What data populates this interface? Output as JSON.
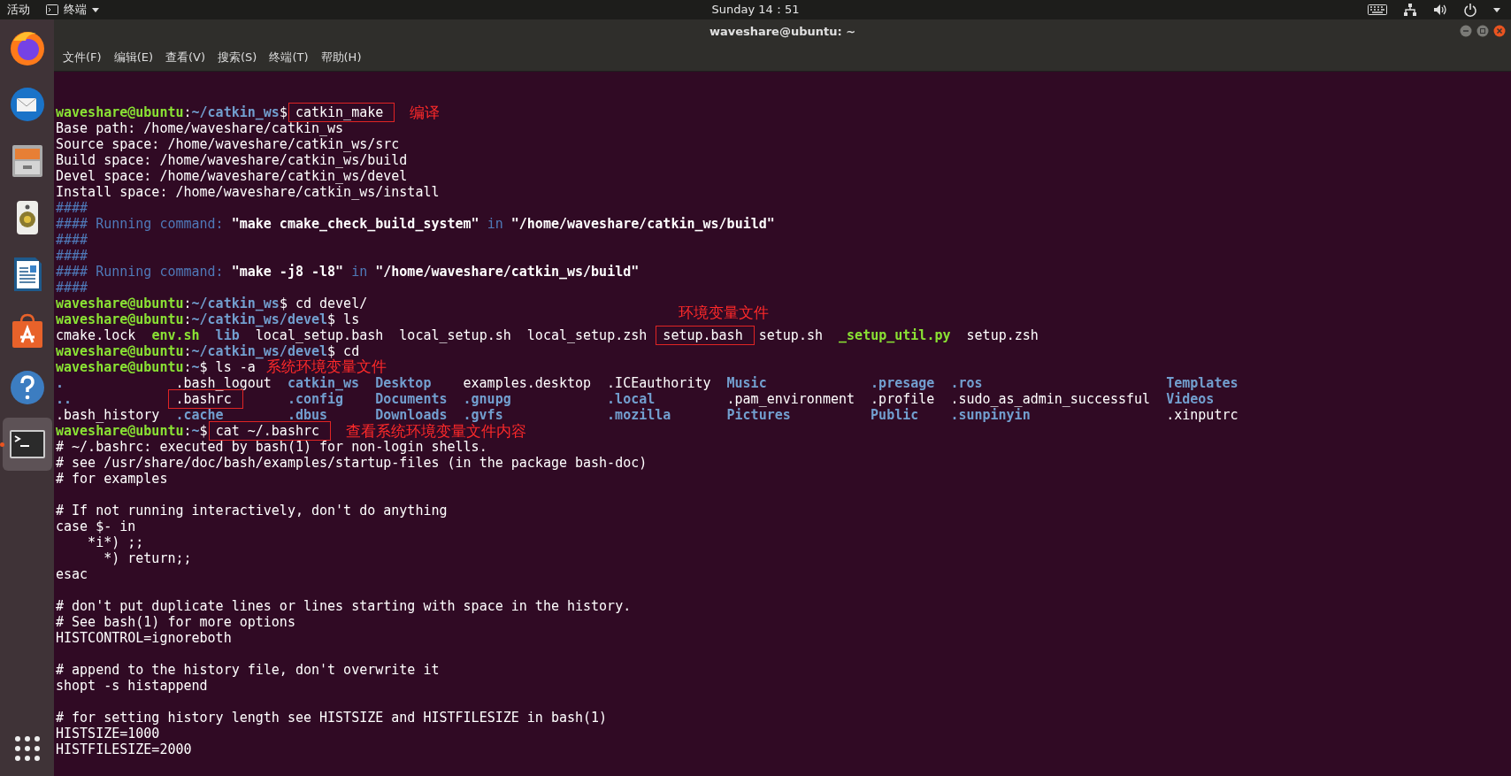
{
  "top_bar": {
    "activities": "活动",
    "app_menu": "终端",
    "clock": "Sunday 14：51"
  },
  "window": {
    "title": "waveshare@ubuntu: ~"
  },
  "menu": [
    "文件(F)",
    "编辑(E)",
    "查看(V)",
    "搜索(S)",
    "终端(T)",
    "帮助(H)"
  ],
  "dock": [
    {
      "kind": "firefox",
      "selected": false
    },
    {
      "kind": "mail",
      "selected": false
    },
    {
      "kind": "files",
      "selected": false
    },
    {
      "kind": "music",
      "selected": false
    },
    {
      "kind": "writer",
      "selected": false
    },
    {
      "kind": "store",
      "selected": false
    },
    {
      "kind": "help",
      "selected": false
    },
    {
      "kind": "terminal",
      "selected": true
    }
  ],
  "terminal": {
    "lines": [
      {
        "kind": "text",
        "segs": [
          {
            "text": "waveshare@ubuntu",
            "kind": "user"
          },
          {
            "text": ":",
            "kind": "plain"
          },
          {
            "text": "~/catkin_ws",
            "kind": "path"
          },
          {
            "text": "$ ",
            "kind": "plain"
          },
          {
            "text": "catkin_make",
            "kind": "plain",
            "box": {
              "note": "编译"
            }
          }
        ]
      },
      {
        "kind": "text",
        "segs": [
          {
            "text": "Base path: /home/waveshare/catkin_ws",
            "kind": "plain"
          }
        ]
      },
      {
        "kind": "text",
        "segs": [
          {
            "text": "Source space: /home/waveshare/catkin_ws/src",
            "kind": "plain"
          }
        ]
      },
      {
        "kind": "text",
        "segs": [
          {
            "text": "Build space: /home/waveshare/catkin_ws/build",
            "kind": "plain"
          }
        ]
      },
      {
        "kind": "text",
        "segs": [
          {
            "text": "Devel space: /home/waveshare/catkin_ws/devel",
            "kind": "plain"
          }
        ]
      },
      {
        "kind": "text",
        "segs": [
          {
            "text": "Install space: /home/waveshare/catkin_ws/install",
            "kind": "plain"
          }
        ]
      },
      {
        "kind": "text",
        "segs": [
          {
            "text": "####",
            "kind": "hash"
          }
        ]
      },
      {
        "kind": "text",
        "segs": [
          {
            "text": "#### Running command: ",
            "kind": "hash"
          },
          {
            "text": "\"make cmake_check_build_system\"",
            "kind": "str"
          },
          {
            "text": " in ",
            "kind": "hash"
          },
          {
            "text": "\"/home/waveshare/catkin_ws/build\"",
            "kind": "str"
          }
        ]
      },
      {
        "kind": "text",
        "segs": [
          {
            "text": "####",
            "kind": "hash"
          }
        ]
      },
      {
        "kind": "text",
        "segs": [
          {
            "text": "####",
            "kind": "hash"
          }
        ]
      },
      {
        "kind": "text",
        "segs": [
          {
            "text": "#### Running command: ",
            "kind": "hash"
          },
          {
            "text": "\"make -j8 -l8\"",
            "kind": "str"
          },
          {
            "text": " in ",
            "kind": "hash"
          },
          {
            "text": "\"/home/waveshare/catkin_ws/build\"",
            "kind": "str"
          }
        ]
      },
      {
        "kind": "text",
        "segs": [
          {
            "text": "####",
            "kind": "hash"
          }
        ]
      },
      {
        "kind": "text",
        "segs": [
          {
            "text": "waveshare@ubuntu",
            "kind": "user"
          },
          {
            "text": ":",
            "kind": "plain"
          },
          {
            "text": "~/catkin_ws",
            "kind": "path"
          },
          {
            "text": "$ cd devel/",
            "kind": "plain"
          }
        ]
      },
      {
        "kind": "text",
        "segs": [
          {
            "text": "waveshare@ubuntu",
            "kind": "user"
          },
          {
            "text": ":",
            "kind": "plain"
          },
          {
            "text": "~/catkin_ws/devel",
            "kind": "path"
          },
          {
            "text": "$ ls",
            "kind": "plain"
          }
        ]
      },
      {
        "kind": "text",
        "segs": [
          {
            "text": "cmake.lock  ",
            "kind": "plain"
          },
          {
            "text": "env.sh",
            "kind": "exec"
          },
          {
            "text": "  lib",
            "kind": "dir"
          },
          {
            "text": "  local_setup.bash  local_setup.sh  local_setup.zsh  ",
            "kind": "plain"
          },
          {
            "text": "setup.bash",
            "kind": "plain",
            "box": {
              "note": "环境变量文件"
            }
          },
          {
            "text": "  setup.sh  ",
            "kind": "plain"
          },
          {
            "text": "_setup_util.py",
            "kind": "exec"
          },
          {
            "text": "  setup.zsh",
            "kind": "plain"
          }
        ]
      },
      {
        "kind": "text",
        "segs": [
          {
            "text": "waveshare@ubuntu",
            "kind": "user"
          },
          {
            "text": ":",
            "kind": "plain"
          },
          {
            "text": "~/catkin_ws/devel",
            "kind": "path"
          },
          {
            "text": "$ cd",
            "kind": "plain"
          }
        ]
      },
      {
        "kind": "text",
        "segs": [
          {
            "text": "waveshare@ubuntu",
            "kind": "user"
          },
          {
            "text": ":",
            "kind": "plain"
          },
          {
            "text": "~",
            "kind": "path"
          },
          {
            "text": "$ ls -a",
            "kind": "plain"
          }
        ]
      },
      {
        "kind": "grid",
        "cells": [
          {
            "text": ".",
            "kind": "dir"
          },
          {
            "text": ".bash_logout",
            "kind": "plain"
          },
          {
            "text": "catkin_ws",
            "kind": "dir"
          },
          {
            "text": "Desktop",
            "kind": "dir"
          },
          {
            "text": "examples.desktop",
            "kind": "plain"
          },
          {
            "text": ".ICEauthority",
            "kind": "plain"
          },
          {
            "text": "Music",
            "kind": "dir"
          },
          {
            "text": ".presage",
            "kind": "dir"
          },
          {
            "text": ".ros",
            "kind": "dir"
          },
          {
            "text": "Templates",
            "kind": "dir"
          }
        ]
      },
      {
        "kind": "grid",
        "cells": [
          {
            "text": "..",
            "kind": "dir"
          },
          {
            "text": ".bashrc",
            "kind": "plain",
            "box": {
              "note": "系统环境变量文件"
            }
          },
          {
            "text": ".config",
            "kind": "dir"
          },
          {
            "text": "Documents",
            "kind": "dir"
          },
          {
            "text": ".gnupg",
            "kind": "dir"
          },
          {
            "text": ".local",
            "kind": "dir"
          },
          {
            "text": ".pam_environment",
            "kind": "plain"
          },
          {
            "text": ".profile",
            "kind": "plain"
          },
          {
            "text": ".sudo_as_admin_successful",
            "kind": "plain"
          },
          {
            "text": "Videos",
            "kind": "dir"
          }
        ]
      },
      {
        "kind": "grid",
        "cells": [
          {
            "text": ".bash_history",
            "kind": "plain"
          },
          {
            "text": ".cache",
            "kind": "dir"
          },
          {
            "text": ".dbus",
            "kind": "dir"
          },
          {
            "text": "Downloads",
            "kind": "dir"
          },
          {
            "text": ".gvfs",
            "kind": "dir"
          },
          {
            "text": ".mozilla",
            "kind": "dir"
          },
          {
            "text": "Pictures",
            "kind": "dir"
          },
          {
            "text": "Public",
            "kind": "dir"
          },
          {
            "text": ".sunpinyin",
            "kind": "dir"
          },
          {
            "text": ".xinputrc",
            "kind": "plain"
          }
        ]
      },
      {
        "kind": "text",
        "segs": [
          {
            "text": "waveshare@ubuntu",
            "kind": "user"
          },
          {
            "text": ":",
            "kind": "plain"
          },
          {
            "text": "~",
            "kind": "path"
          },
          {
            "text": "$ ",
            "kind": "plain"
          },
          {
            "text": "cat ~/.bashrc",
            "kind": "plain",
            "box": {
              "note": "查看系统环境变量文件内容"
            }
          }
        ]
      },
      {
        "kind": "text",
        "segs": [
          {
            "text": "# ~/.bashrc: executed by bash(1) for non-login shells.",
            "kind": "plain"
          }
        ]
      },
      {
        "kind": "text",
        "segs": [
          {
            "text": "# see /usr/share/doc/bash/examples/startup-files (in the package bash-doc)",
            "kind": "plain"
          }
        ]
      },
      {
        "kind": "text",
        "segs": [
          {
            "text": "# for examples",
            "kind": "plain"
          }
        ]
      },
      {
        "kind": "blank"
      },
      {
        "kind": "text",
        "segs": [
          {
            "text": "# If not running interactively, don't do anything",
            "kind": "plain"
          }
        ]
      },
      {
        "kind": "text",
        "segs": [
          {
            "text": "case $- in",
            "kind": "plain"
          }
        ]
      },
      {
        "kind": "text",
        "segs": [
          {
            "text": "    *i*) ;;",
            "kind": "plain"
          }
        ]
      },
      {
        "kind": "text",
        "segs": [
          {
            "text": "      *) return;;",
            "kind": "plain"
          }
        ]
      },
      {
        "kind": "text",
        "segs": [
          {
            "text": "esac",
            "kind": "plain"
          }
        ]
      },
      {
        "kind": "blank"
      },
      {
        "kind": "text",
        "segs": [
          {
            "text": "# don't put duplicate lines or lines starting with space in the history.",
            "kind": "plain"
          }
        ]
      },
      {
        "kind": "text",
        "segs": [
          {
            "text": "# See bash(1) for more options",
            "kind": "plain"
          }
        ]
      },
      {
        "kind": "text",
        "segs": [
          {
            "text": "HISTCONTROL=ignoreboth",
            "kind": "plain"
          }
        ]
      },
      {
        "kind": "blank"
      },
      {
        "kind": "text",
        "segs": [
          {
            "text": "# append to the history file, don't overwrite it",
            "kind": "plain"
          }
        ]
      },
      {
        "kind": "text",
        "segs": [
          {
            "text": "shopt -s histappend",
            "kind": "plain"
          }
        ]
      },
      {
        "kind": "blank"
      },
      {
        "kind": "text",
        "segs": [
          {
            "text": "# for setting history length see HISTSIZE and HISTFILESIZE in bash(1)",
            "kind": "plain"
          }
        ]
      },
      {
        "kind": "text",
        "segs": [
          {
            "text": "HISTSIZE=1000",
            "kind": "plain"
          }
        ]
      },
      {
        "kind": "text",
        "segs": [
          {
            "text": "HISTFILESIZE=2000",
            "kind": "plain"
          }
        ]
      }
    ]
  }
}
